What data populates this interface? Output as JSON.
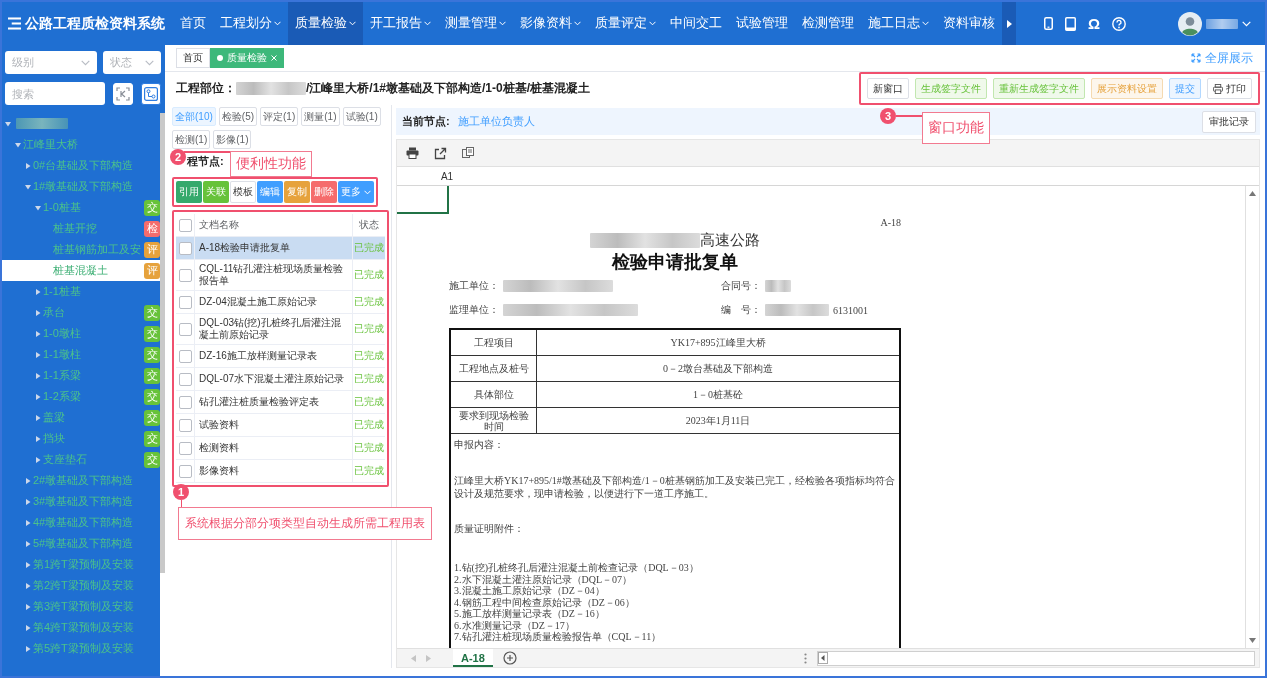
{
  "header": {
    "logo": "公路工程质检资料系统",
    "nav": [
      {
        "label": "首页",
        "dropdown": false,
        "selected": false
      },
      {
        "label": "工程划分",
        "dropdown": true,
        "selected": false
      },
      {
        "label": "质量检验",
        "dropdown": true,
        "selected": true
      },
      {
        "label": "开工报告",
        "dropdown": true,
        "selected": false
      },
      {
        "label": "测量管理",
        "dropdown": true,
        "selected": false
      },
      {
        "label": "影像资料",
        "dropdown": true,
        "selected": false
      },
      {
        "label": "质量评定",
        "dropdown": true,
        "selected": false
      },
      {
        "label": "中间交工",
        "dropdown": false,
        "selected": false
      },
      {
        "label": "试验管理",
        "dropdown": false,
        "selected": false
      },
      {
        "label": "检测管理",
        "dropdown": false,
        "selected": false
      },
      {
        "label": "施工日志",
        "dropdown": true,
        "selected": false
      },
      {
        "label": "资料审核",
        "dropdown": false,
        "selected": false
      }
    ],
    "tools": [
      {
        "kind": "phone"
      },
      {
        "kind": "tablet"
      },
      {
        "kind": "glyph",
        "glyph": "Ω"
      },
      {
        "kind": "help"
      }
    ]
  },
  "sidebar": {
    "level_select": {
      "placeholder": "级别"
    },
    "status_select": {
      "placeholder": "状态"
    },
    "search": {
      "placeholder": "搜索"
    },
    "tree": [
      {
        "expanded": true,
        "selected": false,
        "children": [
          {
            "label": "江峰里大桥",
            "expanded": true,
            "selected": false,
            "children": [
              {
                "label": "0#台基础及下部构造",
                "expanded": false,
                "selected": false
              },
              {
                "label": "1#墩基础及下部构造",
                "expanded": true,
                "selected": false,
                "children": [
                  {
                    "label": "1-0桩基",
                    "expanded": true,
                    "selected": false,
                    "badge": {
                      "text": "交",
                      "color": "#67c23a"
                    },
                    "children": [
                      {
                        "label": "桩基开挖",
                        "selected": false,
                        "badge": {
                          "text": "检",
                          "color": "#f56c6c"
                        }
                      },
                      {
                        "label": "桩基钢筋加工及安",
                        "selected": false,
                        "badge": {
                          "text": "评",
                          "color": "#e6a23c"
                        }
                      },
                      {
                        "label": "桩基混凝土",
                        "selected": true,
                        "badge": {
                          "text": "评",
                          "color": "#e6a23c"
                        }
                      }
                    ]
                  },
                  {
                    "label": "1-1桩基",
                    "expanded": false,
                    "selected": false
                  },
                  {
                    "label": "承台",
                    "expanded": false,
                    "selected": false,
                    "badge": {
                      "text": "交",
                      "color": "#67c23a"
                    }
                  },
                  {
                    "label": "1-0墩柱",
                    "expanded": false,
                    "selected": false,
                    "badge": {
                      "text": "交",
                      "color": "#67c23a"
                    }
                  },
                  {
                    "label": "1-1墩柱",
                    "expanded": false,
                    "selected": false,
                    "badge": {
                      "text": "交",
                      "color": "#67c23a"
                    }
                  },
                  {
                    "label": "1-1系梁",
                    "expanded": false,
                    "selected": false,
                    "badge": {
                      "text": "交",
                      "color": "#67c23a"
                    }
                  },
                  {
                    "label": "1-2系梁",
                    "expanded": false,
                    "selected": false,
                    "badge": {
                      "text": "交",
                      "color": "#67c23a"
                    }
                  },
                  {
                    "label": "盖梁",
                    "expanded": false,
                    "selected": false,
                    "badge": {
                      "text": "交",
                      "color": "#67c23a"
                    }
                  },
                  {
                    "label": "挡块",
                    "expanded": false,
                    "selected": false,
                    "badge": {
                      "text": "交",
                      "color": "#67c23a"
                    }
                  },
                  {
                    "label": "支座垫石",
                    "expanded": false,
                    "selected": false,
                    "badge": {
                      "text": "交",
                      "color": "#67c23a"
                    }
                  }
                ]
              },
              {
                "label": "2#墩基础及下部构造",
                "expanded": false,
                "selected": false
              },
              {
                "label": "3#墩基础及下部构造",
                "expanded": false,
                "selected": false
              },
              {
                "label": "4#墩基础及下部构造",
                "expanded": false,
                "selected": false
              },
              {
                "label": "5#墩基础及下部构造",
                "expanded": false,
                "selected": false
              },
              {
                "label": "第1跨T梁预制及安装",
                "expanded": false,
                "selected": false
              },
              {
                "label": "第2跨T梁预制及安装",
                "expanded": false,
                "selected": false
              },
              {
                "label": "第3跨T梁预制及安装",
                "expanded": false,
                "selected": false
              },
              {
                "label": "第4跨T梁预制及安装",
                "expanded": false,
                "selected": false
              },
              {
                "label": "第5跨T梁预制及安装",
                "expanded": false,
                "selected": false
              }
            ]
          }
        ]
      }
    ]
  },
  "main": {
    "tabs": [
      {
        "label": "首页",
        "selected": false,
        "closable": false
      },
      {
        "label": "质量检验",
        "selected": true,
        "closable": true
      }
    ],
    "fullscreen": "全屏展示",
    "location": {
      "label": "工程部位：",
      "path": "/江峰里大桥/1#墩基础及下部构造/1-0桩基/桩基混凝土"
    },
    "actions": [
      {
        "label": "新窗口",
        "kind": "plain"
      },
      {
        "label": "生成签字文件",
        "kind": "success"
      },
      {
        "label": "重新生成签字文件",
        "kind": "success"
      },
      {
        "label": "展示资料设置",
        "kind": "warning"
      },
      {
        "label": "提交",
        "kind": "primary"
      },
      {
        "label": "打印",
        "kind": "print"
      }
    ]
  },
  "documents": {
    "filters": [
      {
        "label": "全部(10)",
        "selected": true
      },
      {
        "label": "检验(5)",
        "selected": false
      },
      {
        "label": "评定(1)",
        "selected": false
      },
      {
        "label": "测量(1)",
        "selected": false
      },
      {
        "label": "试验(1)",
        "selected": false
      },
      {
        "label": "检测(1)",
        "selected": false
      },
      {
        "label": "影像(1)",
        "selected": false
      }
    ],
    "node_label": "程节点:",
    "buttons": [
      {
        "label": "引用",
        "kind": "teal"
      },
      {
        "label": "关联",
        "kind": "success"
      },
      {
        "label": "模板",
        "kind": "plain"
      },
      {
        "label": "编辑",
        "kind": "primary"
      },
      {
        "label": "复制",
        "kind": "warning"
      },
      {
        "label": "删除",
        "kind": "danger"
      },
      {
        "label": "更多",
        "kind": "more"
      }
    ],
    "table": {
      "columns": [
        "文档名称",
        "状态"
      ],
      "all_checked": false,
      "rows": [
        {
          "name": "A-18检验申请批复单",
          "status": "已完成",
          "selected": true,
          "checked": false
        },
        {
          "name": "CQL-11钻孔灌注桩现场质量检验报告单",
          "status": "已完成",
          "selected": false,
          "checked": false
        },
        {
          "name": "DZ-04混凝土施工原始记录",
          "status": "已完成",
          "selected": false,
          "checked": false
        },
        {
          "name": "DQL-03钻(挖)孔桩终孔后灌注混凝土前原始记录",
          "status": "已完成",
          "selected": false,
          "checked": false
        },
        {
          "name": "DZ-16施工放样测量记录表",
          "status": "已完成",
          "selected": false,
          "checked": false
        },
        {
          "name": "DQL-07水下混凝土灌注原始记录",
          "status": "已完成",
          "selected": false,
          "checked": false
        },
        {
          "name": "钻孔灌注桩质量检验评定表",
          "status": "已完成",
          "selected": false,
          "checked": false
        },
        {
          "name": "试验资料",
          "status": "已完成",
          "selected": false,
          "checked": false
        },
        {
          "name": "检测资料",
          "status": "已完成",
          "selected": false,
          "checked": false
        },
        {
          "name": "影像资料",
          "status": "已完成",
          "selected": false,
          "checked": false
        }
      ]
    }
  },
  "viewer": {
    "node_label": "当前节点:",
    "node": "施工单位负责人",
    "history_button": "审批记录",
    "cell": "A1",
    "sheets": [
      {
        "label": "A-18",
        "selected": true
      }
    ],
    "document": {
      "code": "A-18",
      "subtitle": "高速公路",
      "title": "检验申请批复单",
      "fields": [
        [
          {
            "label": "施工单位："
          },
          {
            "label": "合同号："
          }
        ],
        [
          {
            "label": "监理单位："
          },
          {
            "label": "编　号：",
            "value": "6131001"
          }
        ]
      ],
      "rows": [
        {
          "label": "工程项目",
          "value": "YK17+895江峰里大桥"
        },
        {
          "label": "工程地点及桩号",
          "value": "0－2墩台基础及下部构造"
        },
        {
          "label": "具体部位",
          "value": "1－0桩基砼"
        },
        {
          "label": "要求到现场检验时间",
          "value": "2023年1月11日"
        }
      ],
      "content": {
        "heading": "申报内容：",
        "paragraph": "江峰里大桥YK17+895/1#墩基础及下部构造/1－0桩基钢筋加工及安装已完工，经检验各项指标均符合设计及规范要求，现申请检验，以便进行下一道工序施工。",
        "attachments_heading": "质量证明附件：",
        "attachments": [
          "1.钻(挖)孔桩终孔后灌注混凝土前检查记录（DQL－03）",
          "2.水下混凝土灌注原始记录（DQL－07）",
          "3.混凝土施工原始记录（DZ－04）",
          "4.钢筋工程中间检查原始记录（DZ－06）",
          "5.施工放样测量记录表（DZ－16）",
          "6.水准测量记录（DZ－17）",
          "7.钻孔灌注桩现场质量检验报告单（CQL－11）"
        ]
      }
    }
  },
  "annotations": [
    {
      "number": "3",
      "text": "窗口功能"
    },
    {
      "number": "2",
      "text": "便利性功能"
    },
    {
      "number": "1",
      "text": "系统根据分部分项类型自动生成所需工程用表"
    }
  ]
}
